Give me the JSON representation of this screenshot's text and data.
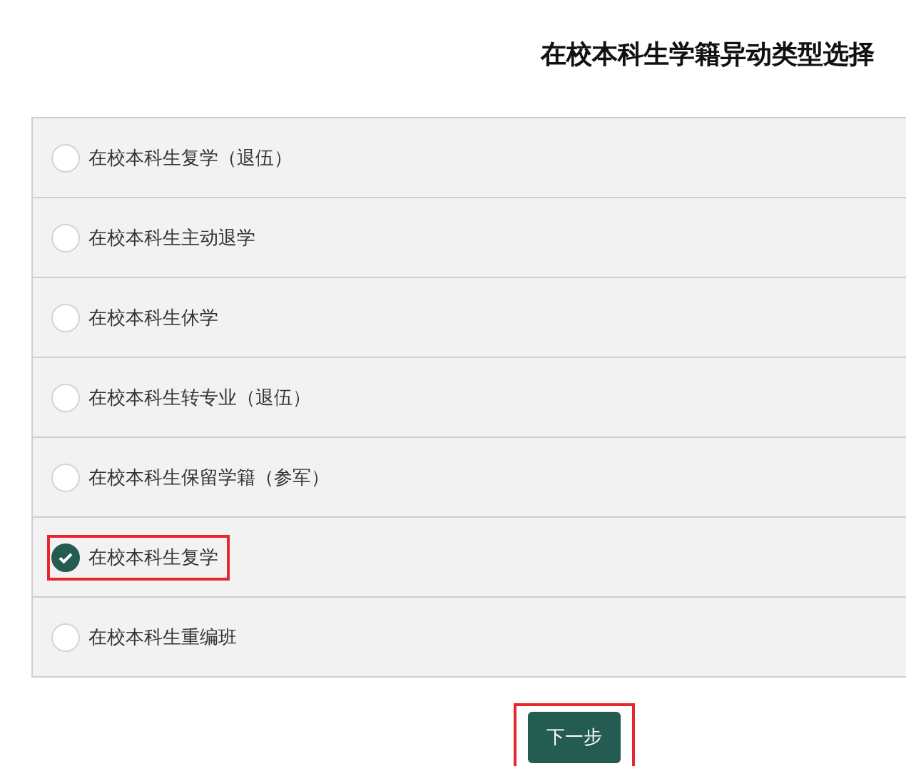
{
  "title": "在校本科生学籍异动类型选择",
  "options": [
    {
      "label": "在校本科生复学（退伍）",
      "selected": false,
      "highlighted": false
    },
    {
      "label": "在校本科生主动退学",
      "selected": false,
      "highlighted": false
    },
    {
      "label": "在校本科生休学",
      "selected": false,
      "highlighted": false
    },
    {
      "label": "在校本科生转专业（退伍）",
      "selected": false,
      "highlighted": false
    },
    {
      "label": "在校本科生保留学籍（参军）",
      "selected": false,
      "highlighted": false
    },
    {
      "label": "在校本科生复学",
      "selected": true,
      "highlighted": true
    },
    {
      "label": "在校本科生重编班",
      "selected": false,
      "highlighted": false
    }
  ],
  "next_button": {
    "label": "下一步",
    "highlighted": true
  }
}
